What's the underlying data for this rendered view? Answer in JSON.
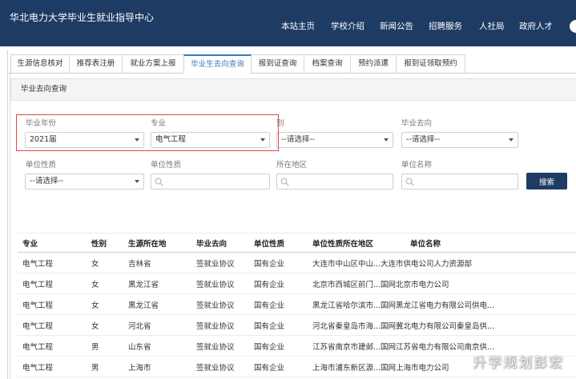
{
  "colors": {
    "header_bg": "#1e3b64",
    "active_tab": "#3a7cc0",
    "highlight_box": "#e0464b",
    "button_bg": "#1e3b64"
  },
  "header": {
    "title": "华北电力大学毕业生就业指导中心",
    "nav": [
      "本站主页",
      "学校介绍",
      "新闻公告",
      "招聘服务",
      "人社局",
      "政府人才"
    ]
  },
  "tabs": [
    {
      "label": "生源信息核对",
      "active": false
    },
    {
      "label": "推荐表注册",
      "active": false
    },
    {
      "label": "就业方案上报",
      "active": false
    },
    {
      "label": "毕业生去向查询",
      "active": true
    },
    {
      "label": "报到证查询",
      "active": false
    },
    {
      "label": "档案查询",
      "active": false
    },
    {
      "label": "预约派遣",
      "active": false
    },
    {
      "label": "报到证领取预约",
      "active": false
    }
  ],
  "panel": {
    "title": "毕业去向查询"
  },
  "icons": {
    "select_caret": "chevron-down-icon",
    "input_search": "search-icon"
  },
  "filters": {
    "graduation_year": {
      "label": "毕业年份",
      "value": "2021届"
    },
    "major": {
      "label": "专业",
      "value": "电气工程"
    },
    "gender": {
      "label": "别",
      "value": "--请选择--"
    },
    "destination": {
      "label": "毕业去向",
      "value": "--请选择--"
    },
    "unit_type": {
      "label": "单位性质",
      "value": "--请选择--"
    },
    "unit_type_search": {
      "label": "单位性质"
    },
    "region": {
      "label": "所在地区"
    },
    "unit_name": {
      "label": "单位名称"
    },
    "search_button": "搜索"
  },
  "table": {
    "columns": [
      "专业",
      "性别",
      "生源所在地",
      "毕业去向",
      "单位性质",
      "单位性质所在地区",
      "单位名称"
    ],
    "rows": [
      [
        "电气工程",
        "女",
        "吉林省",
        "签就业协议",
        "国有企业",
        "大连市中山区中山...",
        "大连市供电公司人力资源部"
      ],
      [
        "电气工程",
        "女",
        "黑龙江省",
        "签就业协议",
        "国有企业",
        "北京市西城区前门...",
        "国网北京市电力公司"
      ],
      [
        "电气工程",
        "女",
        "黑龙江省",
        "签就业协议",
        "国有企业",
        "黑龙江省哈尔滨市...",
        "国网黑龙江省电力有限公司供电..."
      ],
      [
        "电气工程",
        "女",
        "河北省",
        "签就业协议",
        "国有企业",
        "河北省秦皇岛市海...",
        "国网冀北电力有限公司秦皇岛供..."
      ],
      [
        "电气工程",
        "男",
        "山东省",
        "签就业协议",
        "国有企业",
        "江苏省南京市建邺...",
        "国网江苏省电力有限公司南京供..."
      ],
      [
        "电气工程",
        "男",
        "上海市",
        "签就业协议",
        "国有企业",
        "上海市浦东新区源...",
        "国网上海市电力公司"
      ]
    ]
  },
  "watermark": "升学规划彭宏"
}
